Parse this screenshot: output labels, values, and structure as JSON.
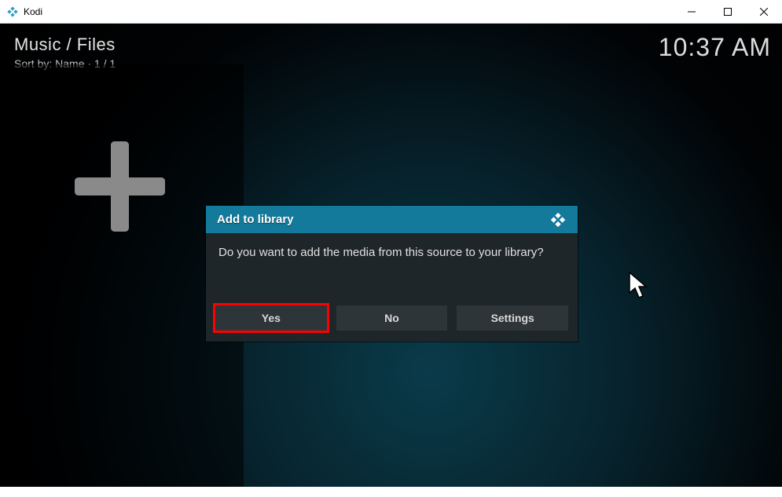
{
  "window": {
    "title": "Kodi",
    "controls": {
      "minimize": "minimize",
      "maximize": "maximize",
      "close": "close"
    }
  },
  "header": {
    "breadcrumb": "Music / Files",
    "sort_line": "Sort by: Name  ·  1 / 1",
    "clock": "10:37 AM"
  },
  "dialog": {
    "title": "Add to library",
    "message": "Do you want to add the media from this source to your library?",
    "buttons": {
      "yes": "Yes",
      "no": "No",
      "settings": "Settings"
    }
  }
}
